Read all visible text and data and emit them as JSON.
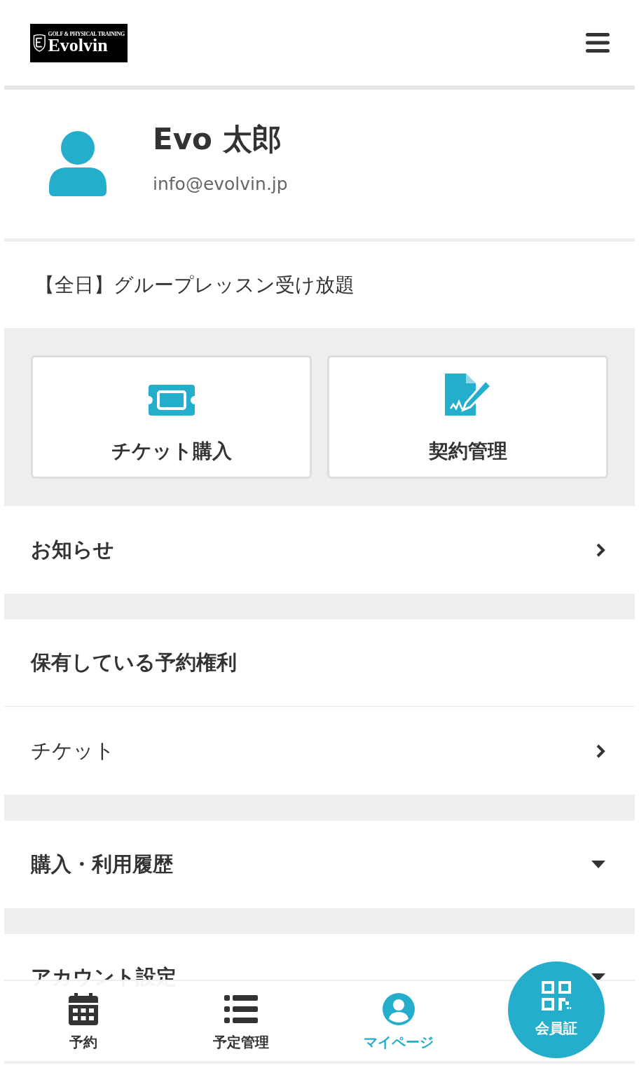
{
  "header": {
    "logo": {
      "tagline": "GOLF & PHYSICAL TRAINING",
      "name": "Evolvin"
    }
  },
  "profile": {
    "name": "Evo 太郎",
    "email": "info@evolvin.jp"
  },
  "plan": "【全日】グループレッスン受け放題",
  "actions": [
    {
      "label": "チケット購入",
      "kind": "ticket"
    },
    {
      "label": "契約管理",
      "kind": "contract"
    }
  ],
  "menu": [
    {
      "label": "お知らせ",
      "kind": "link",
      "bold": true,
      "gap_after": true
    },
    {
      "label": "保有している予約権利",
      "kind": "heading",
      "bold": true,
      "gap_after": false
    },
    {
      "label": "チケット",
      "kind": "link",
      "bold": false,
      "gap_after": true
    },
    {
      "label": "購入・利用履歴",
      "kind": "accordion",
      "bold": true,
      "gap_after": true
    },
    {
      "label": "アカウント設定",
      "kind": "accordion",
      "bold": true,
      "gap_after": false
    }
  ],
  "bottom_nav": [
    {
      "label": "予約",
      "kind": "calendar",
      "selected": false
    },
    {
      "label": "予定管理",
      "kind": "list",
      "selected": false
    },
    {
      "label": "マイページ",
      "kind": "user",
      "selected": true
    }
  ],
  "member_card_button": {
    "label": "会員証"
  }
}
